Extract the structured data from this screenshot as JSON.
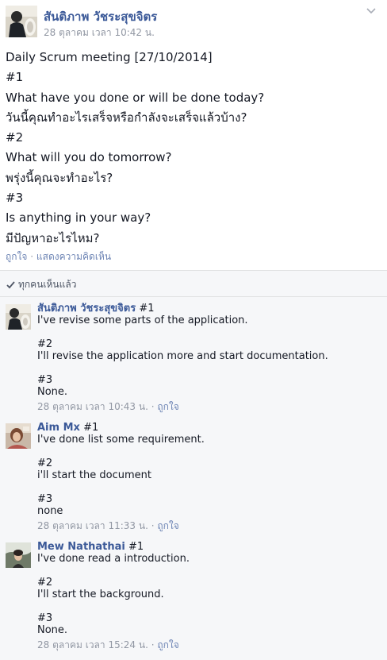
{
  "post": {
    "author": "สันติภาพ วัชระสุขจิตร",
    "timestamp": "28 ตุลาคม เวลา 10:42 น.",
    "lines": [
      "Daily Scrum meeting [27/10/2014]",
      "#1",
      "What have you done or will be done today?",
      "วันนี้คุณทำอะไรเสร็จหรือกำลังจะเสร็จแล้วบ้าง?",
      "#2",
      "What will you do tomorrow?",
      "พรุ่งนี้คุณจะทำอะไร?",
      "#3",
      "Is anything in your way?",
      "มีปัญหาอะไรไหม?"
    ],
    "actions": {
      "like": "ถูกใจ",
      "separator": "·",
      "comment": "แสดงความคิดเห็น"
    }
  },
  "feedback": {
    "seen_by": "ทุกคนเห็นแล้ว",
    "comments": [
      {
        "name": "สันติภาพ วัชระสุขจิตร",
        "first": "#1",
        "lines": [
          "I've revise some parts of the application.",
          "",
          "#2",
          "I'll revise the application more and start documentation.",
          "",
          "#3",
          "None."
        ],
        "time": "28 ตุลาคม เวลา 10:43 น.",
        "dot": "·",
        "like": "ถูกใจ"
      },
      {
        "name": "Aim Mx",
        "first": "#1",
        "lines": [
          "I've done list some requirement.",
          "",
          "#2",
          "i'll start the document",
          "",
          "#3",
          "none"
        ],
        "time": "28 ตุลาคม เวลา 11:33 น.",
        "dot": "·",
        "like": "ถูกใจ"
      },
      {
        "name": "Mew Nathathai",
        "first": "#1",
        "lines": [
          "I've done read a introduction.",
          "",
          "#2",
          "I'll start the background.",
          "",
          "#3",
          "None."
        ],
        "time": "28 ตุลาคม เวลา 15:24 น.",
        "dot": "·",
        "like": "ถูกใจ"
      }
    ]
  },
  "colors": {
    "link": "#3b5998",
    "meta": "#9197a3",
    "feedback_bg": "#f6f7f9"
  }
}
